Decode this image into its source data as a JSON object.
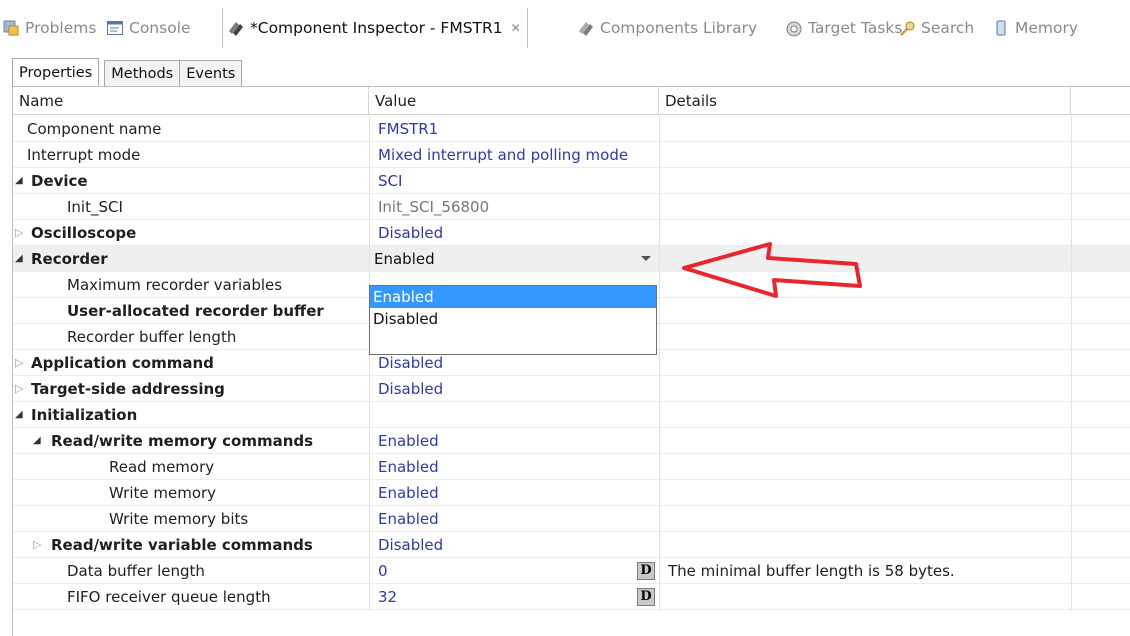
{
  "view_tabs": [
    {
      "label": "Problems",
      "icon": "problems-icon"
    },
    {
      "label": "Console",
      "icon": "console-icon"
    },
    {
      "label": "*Component Inspector - FMSTR1",
      "icon": "component-inspector-icon",
      "active": true
    },
    {
      "label": "Components Library",
      "icon": "components-library-icon"
    },
    {
      "label": "Target Tasks",
      "icon": "target-tasks-icon"
    },
    {
      "label": "Search",
      "icon": "search-icon"
    },
    {
      "label": "Memory",
      "icon": "memory-icon"
    }
  ],
  "sub_tabs": {
    "properties": "Properties",
    "methods": "Methods",
    "events": "Events"
  },
  "columns": {
    "name": "Name",
    "value": "Value",
    "details": "Details"
  },
  "rows": [
    {
      "name": "Component name",
      "value": "FMSTR1",
      "details": ""
    },
    {
      "name": "Interrupt mode",
      "value": "Mixed interrupt and polling mode",
      "details": ""
    },
    {
      "name": "Device",
      "value": "SCI",
      "details": ""
    },
    {
      "name": "Init_SCI",
      "value": "Init_SCI_56800",
      "details": ""
    },
    {
      "name": "Oscilloscope",
      "value": "Disabled",
      "details": ""
    },
    {
      "name": "Recorder",
      "value": "Enabled",
      "details": ""
    },
    {
      "name": "Maximum recorder variables",
      "value": "",
      "details": ""
    },
    {
      "name": "User-allocated recorder buffer",
      "value": "",
      "details": ""
    },
    {
      "name": "Recorder buffer length",
      "value": "",
      "details": ""
    },
    {
      "name": "Application command",
      "value": "Disabled",
      "details": ""
    },
    {
      "name": "Target-side addressing",
      "value": "Disabled",
      "details": ""
    },
    {
      "name": "Initialization",
      "value": "",
      "details": ""
    },
    {
      "name": "Read/write memory commands",
      "value": "Enabled",
      "details": ""
    },
    {
      "name": "Read memory",
      "value": "Enabled",
      "details": ""
    },
    {
      "name": "Write memory",
      "value": "Enabled",
      "details": ""
    },
    {
      "name": "Write memory bits",
      "value": "Enabled",
      "details": ""
    },
    {
      "name": "Read/write variable commands",
      "value": "Disabled",
      "details": ""
    },
    {
      "name": "Data buffer length",
      "value": "0",
      "details": "The minimal buffer length is 58 bytes."
    },
    {
      "name": "FIFO receiver queue length",
      "value": "32",
      "details": ""
    }
  ],
  "dropdown": {
    "options": [
      "Enabled",
      "Disabled"
    ],
    "selected": "Enabled"
  },
  "d_button_label": "D",
  "colors": {
    "value_text": "#2b3ab0",
    "selected_option": "#3399ff",
    "arrow": "#e8262b"
  }
}
